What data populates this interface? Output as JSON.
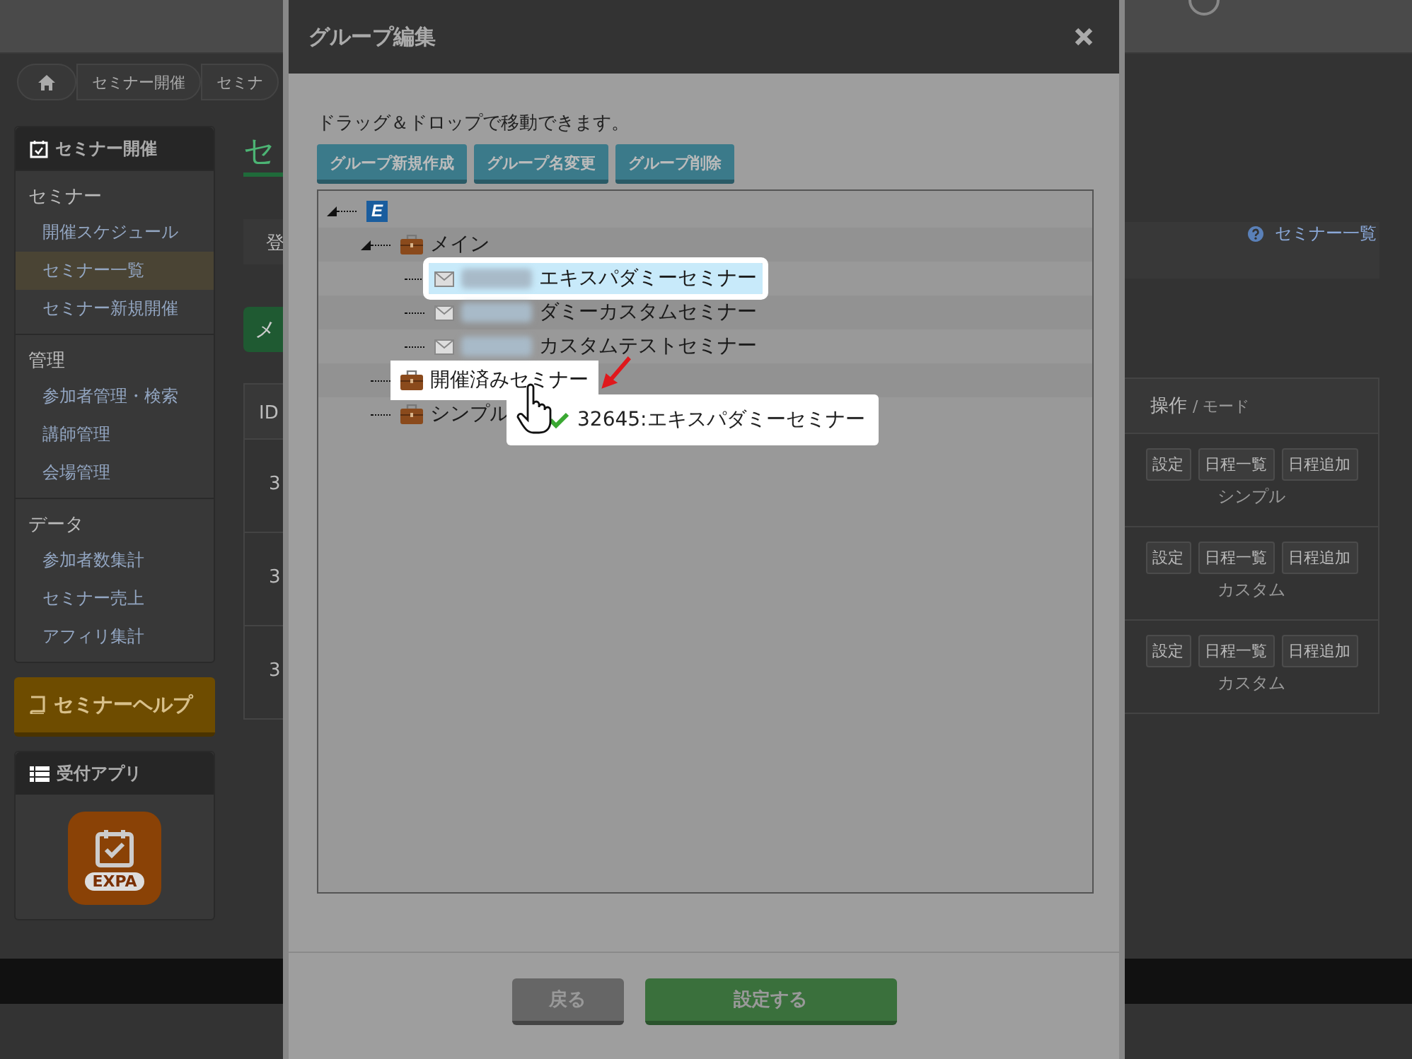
{
  "breadcrumb": [
    {
      "label": "セミナー開催"
    },
    {
      "label": "セミナ"
    }
  ],
  "sidebar": {
    "title": "セミナー開催",
    "groups": [
      {
        "label": "セミナー",
        "items": [
          {
            "label": "開催スケジュール",
            "selected": false
          },
          {
            "label": "セミナー一覧",
            "selected": true
          },
          {
            "label": "セミナー新規開催",
            "selected": false
          }
        ]
      },
      {
        "label": "管理",
        "items": [
          {
            "label": "参加者管理・検索",
            "selected": false
          },
          {
            "label": "講師管理",
            "selected": false
          },
          {
            "label": "会場管理",
            "selected": false
          }
        ]
      },
      {
        "label": "データ",
        "items": [
          {
            "label": "参加者数集計",
            "selected": false
          },
          {
            "label": "セミナー売上",
            "selected": false
          },
          {
            "label": "アフィリ集計",
            "selected": false
          }
        ]
      }
    ],
    "help_button": "セミナーヘルプ",
    "app_panel": {
      "title": "受付アプリ",
      "logo_text": "EXPA"
    }
  },
  "main": {
    "title": "セ",
    "info": "登",
    "action_button": "メ",
    "help_link": "セミナー一覧",
    "table": {
      "id_header": "ID",
      "ops_header": "操作",
      "mode_header": "/ モード",
      "rows": [
        {
          "id": "3",
          "buttons": [
            "設定",
            "日程一覧",
            "日程追加"
          ],
          "mode": "シンプル"
        },
        {
          "id": "3",
          "buttons": [
            "設定",
            "日程一覧",
            "日程追加"
          ],
          "mode": "カスタム"
        },
        {
          "id": "3",
          "buttons": [
            "設定",
            "日程一覧",
            "日程追加"
          ],
          "mode": "カスタム"
        }
      ]
    }
  },
  "modal": {
    "title": "グループ編集",
    "hint": "ドラッグ＆ドロップで移動できます。",
    "buttons": [
      "グループ新規作成",
      "グループ名変更",
      "グループ削除"
    ],
    "tree": {
      "kind": "root",
      "logo": "E",
      "expanded": true,
      "children": [
        {
          "kind": "folder",
          "label": "メイン",
          "expanded": true,
          "drop_target": false,
          "children": [
            {
              "kind": "item",
              "label": "エキスパダミーセミナー",
              "selected": true
            },
            {
              "kind": "item",
              "label": "ダミーカスタムセミナー",
              "selected": false
            },
            {
              "kind": "item",
              "label": "カスタムテストセミナー",
              "selected": false
            }
          ]
        },
        {
          "kind": "folder",
          "label": "開催済みセミナー",
          "expanded": false,
          "drop_target": true
        },
        {
          "kind": "folder",
          "label": "シンプル",
          "expanded": false,
          "drop_target": false
        }
      ]
    },
    "drag_helper": "32645:エキスパダミーセミナー",
    "footer_buttons": [
      {
        "label": "戻る",
        "kind": "back"
      },
      {
        "label": "設定する",
        "kind": "submit"
      }
    ]
  }
}
